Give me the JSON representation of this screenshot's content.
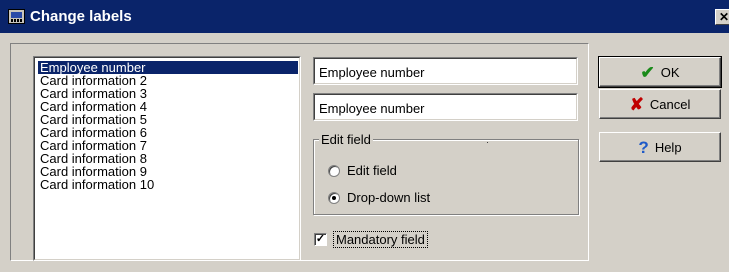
{
  "window": {
    "title": "Change labels",
    "close_glyph": "✕",
    "icon": "app-keyboard-icon"
  },
  "list": {
    "selected_index": 0,
    "items": [
      "Employee number",
      "Card information 2",
      "Card information 3",
      "Card information 4",
      "Card information 5",
      "Card information 6",
      "Card information 7",
      "Card information 8",
      "Card information 9",
      "Card information 10"
    ]
  },
  "fields": {
    "label_value": "Employee number",
    "label_value_2": "Employee number"
  },
  "edit_group": {
    "label": "Edit field",
    "options": [
      {
        "label": "Edit field",
        "selected": false
      },
      {
        "label": "Drop-down list",
        "selected": true
      }
    ]
  },
  "mandatory": {
    "label": "Mandatory field",
    "checked": true,
    "check_glyph": "✓"
  },
  "buttons": {
    "ok": {
      "label": "OK",
      "icon": "checkmark-icon",
      "glyph": "✔"
    },
    "cancel": {
      "label": "Cancel",
      "icon": "x-icon",
      "glyph": "✘"
    },
    "help": {
      "label": "Help",
      "icon": "question-icon",
      "glyph": "?"
    }
  },
  "colors": {
    "titlebar": "#0a246a",
    "face": "#d4d0c8",
    "selection": "#0a246a"
  }
}
